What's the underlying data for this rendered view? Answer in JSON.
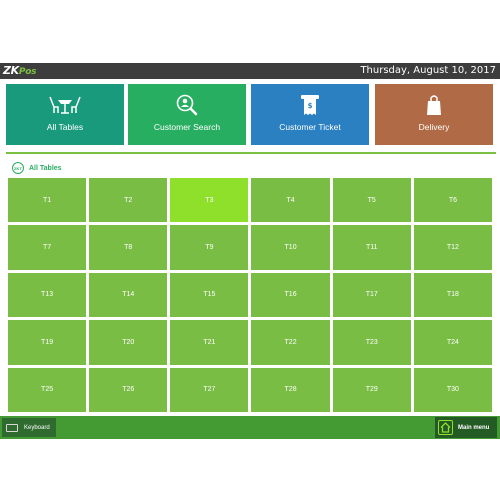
{
  "app": {
    "logo_main": "ZK",
    "logo_sub": "Pos",
    "date": "Thursday, August 10, 2017"
  },
  "tiles": [
    {
      "label": "All Tables",
      "icon": "table-chairs-icon",
      "color": "#1a9a7d"
    },
    {
      "label": "Customer Search",
      "icon": "customer-search-icon",
      "color": "#27ae60"
    },
    {
      "label": "Customer Ticket",
      "icon": "ticket-icon",
      "color": "#2a80c0"
    },
    {
      "label": "Delivery",
      "icon": "shopping-bag-icon",
      "color": "#b06a45"
    }
  ],
  "area": {
    "badge": "ZKT",
    "title": "All Tables"
  },
  "tables": [
    "T1",
    "T2",
    "T3",
    "T4",
    "T5",
    "T6",
    "T7",
    "T8",
    "T9",
    "T10",
    "T11",
    "T12",
    "T13",
    "T14",
    "T15",
    "T16",
    "T17",
    "T18",
    "T19",
    "T20",
    "T21",
    "T22",
    "T23",
    "T24",
    "T25",
    "T26",
    "T27",
    "T28",
    "T29",
    "T30"
  ],
  "selected_table": "T3",
  "bottom": {
    "keyboard_label": "Keyboard",
    "main_menu_label": "Main menu"
  },
  "colors": {
    "accent": "#7bc043",
    "table": "#79bd45",
    "table_selected": "#8ee02b",
    "bottom_bar": "#449a33"
  }
}
